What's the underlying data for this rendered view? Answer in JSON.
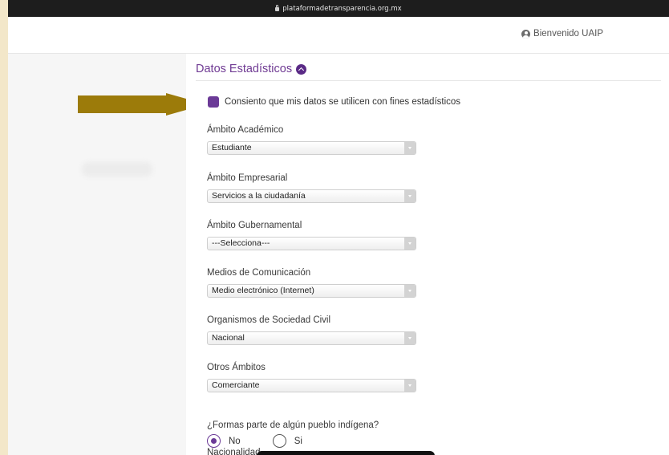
{
  "browser": {
    "url": "plataformadetransparencia.org.mx"
  },
  "header": {
    "welcome": "Bienvenido UAIP"
  },
  "section": {
    "title": "Datos Estadísticos",
    "consent_label": "Consiento que mis datos se utilicen con fines estadísticos",
    "consent_checked": true
  },
  "fields": [
    {
      "label": "Ámbito Académico",
      "value": "Estudiante"
    },
    {
      "label": "Ámbito Empresarial",
      "value": "Servicios a la ciudadanía"
    },
    {
      "label": "Ámbito Gubernamental",
      "value": "---Selecciona---"
    },
    {
      "label": "Medios de Comunicación",
      "value": "Medio electrónico (Internet)"
    },
    {
      "label": "Organismos de Sociedad Civil",
      "value": "Nacional"
    },
    {
      "label": "Otros Ámbitos",
      "value": "Comerciante"
    }
  ],
  "indigenous": {
    "question": "¿Formas parte de algún pueblo indígena?",
    "options": [
      "No",
      "Si"
    ],
    "selected": "No"
  },
  "nationality_label": "Nacionalidad",
  "colors": {
    "accent": "#6b3a97",
    "arrow": "#9c7b0a",
    "slide_bg": "#f3e7c9"
  }
}
